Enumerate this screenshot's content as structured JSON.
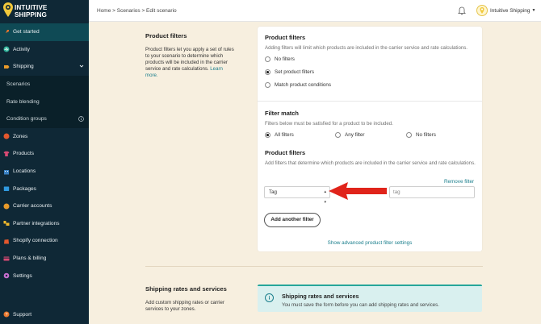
{
  "brand": {
    "line1": "INTUITIVE",
    "line2": "SHIPPING"
  },
  "sidebar": {
    "items": [
      {
        "label": "Get started",
        "icon": "rocket-icon",
        "color": "#e9762b"
      },
      {
        "label": "Activity",
        "icon": "activity-icon",
        "color": "#2fb39a"
      },
      {
        "label": "Shipping",
        "icon": "shipping-icon",
        "color": "#e89a2a"
      },
      {
        "label": "Scenarios"
      },
      {
        "label": "Rate blending"
      },
      {
        "label": "Condition groups"
      },
      {
        "label": "Zones",
        "icon": "globe-icon",
        "color": "#e3572d"
      },
      {
        "label": "Products",
        "icon": "shirt-icon",
        "color": "#d84a74"
      },
      {
        "label": "Locations",
        "icon": "building-icon",
        "color": "#3a82c4"
      },
      {
        "label": "Packages",
        "icon": "package-icon",
        "color": "#2f9ae0"
      },
      {
        "label": "Carrier accounts",
        "icon": "truck-icon",
        "color": "#e89a2a"
      },
      {
        "label": "Partner integrations",
        "icon": "puzzle-icon",
        "color": "#f0b92b"
      },
      {
        "label": "Shopify connection",
        "icon": "shopify-icon",
        "color": "#e3572d"
      },
      {
        "label": "Plans & billing",
        "icon": "card-icon",
        "color": "#d84a74"
      },
      {
        "label": "Settings",
        "icon": "gear-icon",
        "color": "#c86fd0"
      }
    ],
    "support": "Support"
  },
  "topbar": {
    "breadcrumb": "Home > Scenarios > Edit scenario",
    "account": "Intuitive Shipping"
  },
  "product_filters_section": {
    "title": "Product filters",
    "desc": "Product filters let you apply a set of rules to your scenario to determine which products will be included in the carrier service and rate calculations.",
    "learn_more": "Learn more."
  },
  "card": {
    "title": "Product filters",
    "hint": "Adding filters will limit which products are included in the carrier service and rate calculations.",
    "options": [
      "No filters",
      "Set product filters",
      "Match product conditions"
    ],
    "selected_option": 1,
    "match": {
      "title": "Filter match",
      "hint": "Filters below must be satisfied for a product to be included.",
      "options": [
        "All filters",
        "Any filter",
        "No filters"
      ],
      "selected": 0
    },
    "filters": {
      "title": "Product filters",
      "hint": "Add filters that determine which products are included in the carrier service and rate calculations.",
      "remove_label": "Remove filter",
      "field_value": "Tag",
      "value_placeholder": "tag",
      "add_label": "Add another filter",
      "advanced_link": "Show advanced product filter settings"
    }
  },
  "shipping_rates_section": {
    "title": "Shipping rates and services",
    "desc": "Add custom shipping rates or carrier services to your zones.",
    "banner_title": "Shipping rates and services",
    "banner_desc": "You must save the form before you can add shipping rates and services."
  },
  "colors": {
    "accent": "#1a7e8c",
    "sidebar_bg": "#0f2836",
    "arrow": "#e0241b"
  }
}
